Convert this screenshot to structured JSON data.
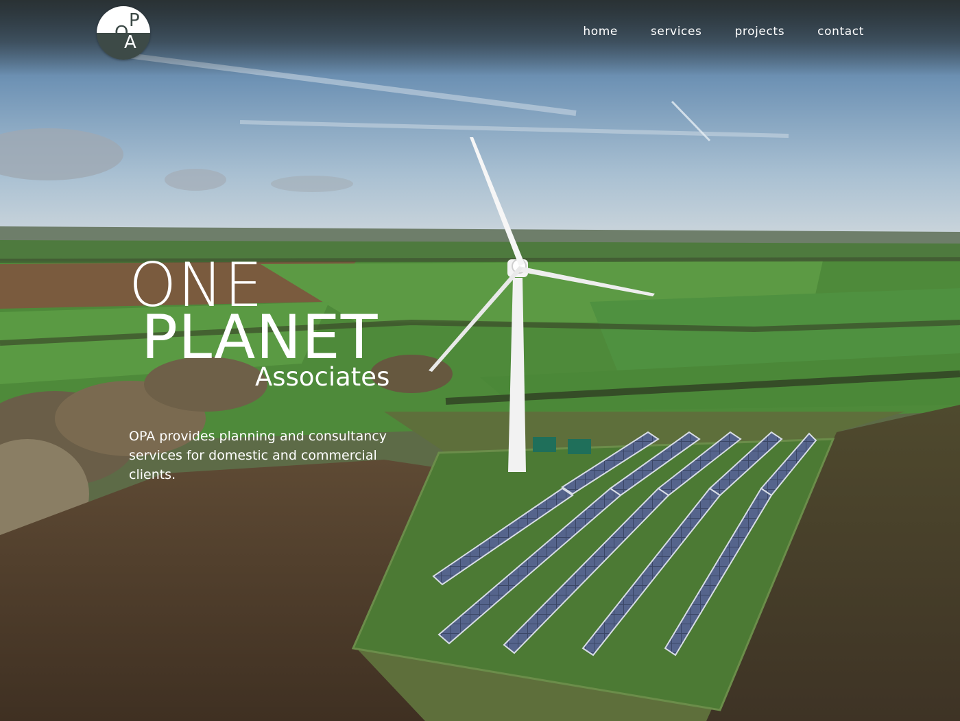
{
  "header": {
    "logo": {
      "text": "OPA",
      "letters": [
        "O",
        "P",
        "A"
      ]
    },
    "nav": [
      {
        "label": "home"
      },
      {
        "label": "services"
      },
      {
        "label": "projects"
      },
      {
        "label": "contact"
      }
    ]
  },
  "hero": {
    "title_line1": "ONE",
    "title_line2": "PLANET",
    "title_line3": "Associates",
    "tagline": "OPA provides planning and consultancy services for domestic and commercial clients.",
    "image_icon": "wind-turbine-solar-farm-landscape"
  },
  "colors": {
    "logo_dark": "#3d4a47",
    "nav_text": "#ffffff",
    "sky": "#6f93b5",
    "field_green": "#4e8a3a",
    "soil": "#5b4630"
  }
}
